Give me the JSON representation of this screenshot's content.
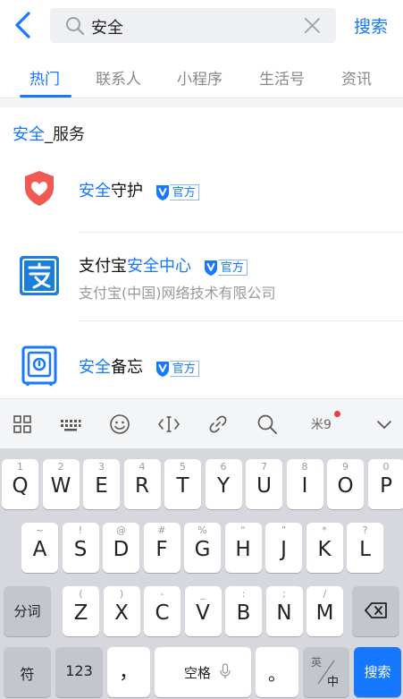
{
  "search": {
    "query": "安全",
    "button_label": "搜索"
  },
  "tabs": [
    {
      "label": "热门",
      "active": true
    },
    {
      "label": "联系人",
      "active": false
    },
    {
      "label": "小程序",
      "active": false
    },
    {
      "label": "生活号",
      "active": false
    },
    {
      "label": "资讯",
      "active": false
    }
  ],
  "section": {
    "title_highlight": "安全",
    "title_rest": "_服务"
  },
  "results": [
    {
      "name_highlight": "安全",
      "name_rest": "守护",
      "name_prefix": "",
      "badge": "官方",
      "subtitle": "",
      "icon": "shield-heart-icon"
    },
    {
      "name_prefix": "支付宝",
      "name_highlight": "安全中心",
      "name_rest": "",
      "badge": "官方",
      "subtitle": "支付宝(中国)网络技术有限公司",
      "icon": "security-center-icon"
    },
    {
      "name_highlight": "安全",
      "name_rest": "备忘",
      "name_prefix": "",
      "badge": "官方",
      "subtitle": "",
      "icon": "safe-box-icon"
    }
  ],
  "keyboard": {
    "toolbar_mi_label": "米9",
    "row1": [
      {
        "hint": "1",
        "key": "Q"
      },
      {
        "hint": "2",
        "key": "W"
      },
      {
        "hint": "3",
        "key": "E"
      },
      {
        "hint": "4",
        "key": "R"
      },
      {
        "hint": "5",
        "key": "T"
      },
      {
        "hint": "6",
        "key": "Y"
      },
      {
        "hint": "7",
        "key": "U"
      },
      {
        "hint": "8",
        "key": "I"
      },
      {
        "hint": "9",
        "key": "O"
      },
      {
        "hint": "0",
        "key": "P"
      }
    ],
    "row2": [
      {
        "hint": "~",
        "key": "A"
      },
      {
        "hint": "!",
        "key": "S"
      },
      {
        "hint": "@",
        "key": "D"
      },
      {
        "hint": "#",
        "key": "F"
      },
      {
        "hint": "%",
        "key": "G"
      },
      {
        "hint": "“",
        "key": "H"
      },
      {
        "hint": "”",
        "key": "J"
      },
      {
        "hint": "*",
        "key": "K"
      },
      {
        "hint": "?",
        "key": "L"
      }
    ],
    "row3": [
      {
        "hint": "(",
        "key": "Z"
      },
      {
        "hint": ")",
        "key": "X"
      },
      {
        "hint": "-",
        "key": "C"
      },
      {
        "hint": "_",
        "key": "V"
      },
      {
        "hint": ":",
        "key": "B"
      },
      {
        "hint": ";",
        "key": "N"
      },
      {
        "hint": "/",
        "key": "M"
      }
    ],
    "fenci_label": "分词",
    "symbol_label": "符",
    "numeric_label": "123",
    "comma_label": "，",
    "space_label": "空格",
    "period_label": "。",
    "lang_en": "英",
    "lang_zh": "中",
    "search_label": "搜索"
  },
  "colors": {
    "accent": "#1677ff",
    "shield_red": "#f05a52",
    "keyboard_bg": "#d6d8dd"
  }
}
